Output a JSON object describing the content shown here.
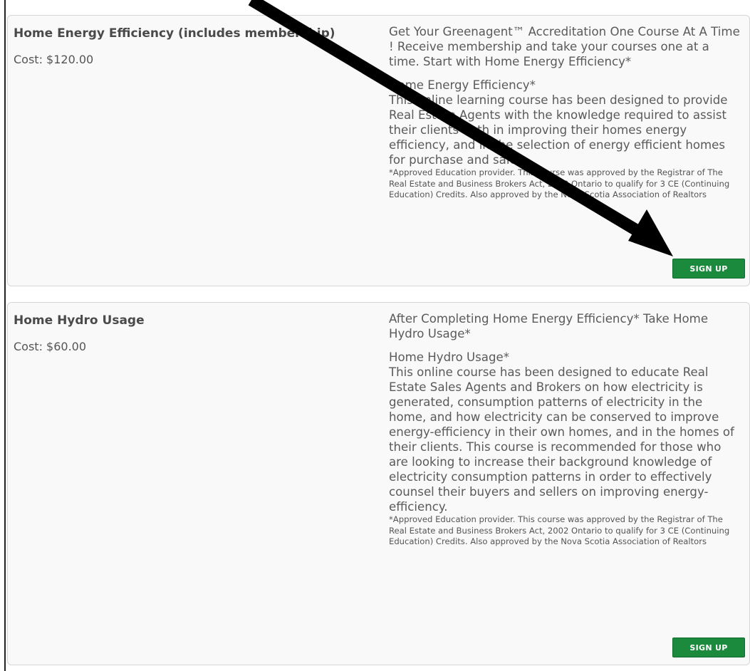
{
  "courses": [
    {
      "title": "Home Energy Efficiency (includes membership)",
      "cost": "Cost: $120.00",
      "intro": "Get Your Greenagent™ Accreditation One Course At A Time ! Receive membership and take your courses one at a time. Start with Home Energy Efficiency*",
      "heading": "Home Energy Efficiency*",
      "description": "This online learning course has been designed to provide Real Estate Agents with the knowledge required to assist their clients both in improving their homes energy efficiency, and in the selection of energy efficient homes for purchase and sale.",
      "approval": "*Approved Education provider. This course was approved by the Registrar of The Real Estate and Business Brokers Act, 2002 Ontario to qualify for 3 CE (Continuing Education) Credits. Also approved by the Nova Scotia Association of Realtors",
      "button": "SIGN UP"
    },
    {
      "title": "Home Hydro Usage",
      "cost": "Cost: $60.00",
      "intro": "After Completing Home Energy Efficiency* Take Home Hydro Usage*",
      "heading": "Home Hydro Usage*",
      "description": "This online course has been designed to educate Real Estate Sales Agents and Brokers on how electricity is generated, consumption patterns of electricity in the home, and how electricity can be conserved to improve energy-efficiency in their own homes, and in the homes of their clients. This course is recommended for those who are looking to increase their background knowledge of electricity consumption patterns in order to effectively counsel their buyers and sellers on improving energy-efficiency.",
      "approval": "*Approved Education provider. This course was approved by the Registrar of The Real Estate and Business Brokers Act, 2002 Ontario to qualify for 3 CE (Continuing Education) Credits. Also approved by the Nova Scotia Association of Realtors",
      "button": "SIGN UP"
    }
  ],
  "annotation": {
    "icon": "arrow-icon",
    "color": "#000000"
  },
  "colors": {
    "button_bg": "#1c8a3c",
    "card_bg": "#f9f9f9",
    "card_border": "#d6d6d6"
  }
}
